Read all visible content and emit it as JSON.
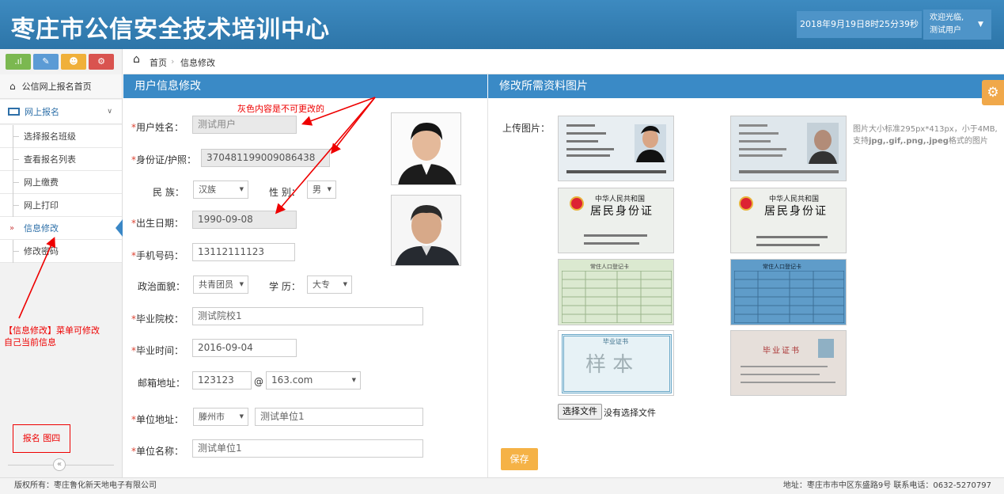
{
  "header": {
    "title": "枣庄市公信安全技术培训中心",
    "datetime": "2018年9月19日8时25分39秒",
    "welcome": "欢迎光临,",
    "username": "测试用户"
  },
  "sidebar": {
    "shortcut_icons": [
      "chart-icon",
      "pencil-icon",
      "group-icon",
      "cogs-icon"
    ],
    "home_label": "公信网上报名首页",
    "section_label": "网上报名",
    "items": [
      {
        "label": "选择报名班级"
      },
      {
        "label": "查看报名列表"
      },
      {
        "label": "网上缴费"
      },
      {
        "label": "网上打印"
      },
      {
        "label": "信息修改"
      },
      {
        "label": "修改密码"
      }
    ],
    "annotation_line1": "【信息修改】菜单可修改",
    "annotation_line2": "自己当前信息",
    "figure_label": "报名 图四",
    "collapse_glyph": "«"
  },
  "breadcrumb": {
    "home": "首页",
    "separator": "›",
    "current": "信息修改"
  },
  "left_panel": {
    "title": "用户信息修改",
    "note": "灰色内容是不可更改的",
    "required_mark": "*",
    "fields": {
      "name": {
        "label": "用户姓名：",
        "value": "测试用户"
      },
      "id": {
        "label": "身份证/护照：",
        "value": "370481199009086438"
      },
      "ethnicity": {
        "label": "民 族：",
        "value": "汉族"
      },
      "gender": {
        "label": "性 别：",
        "value": "男"
      },
      "birth": {
        "label": "出生日期：",
        "value": "1990-09-08"
      },
      "phone": {
        "label": "手机号码：",
        "value": "13112111123"
      },
      "political": {
        "label": "政治面貌：",
        "value": "共青团员"
      },
      "education": {
        "label": "学 历：",
        "value": "大专"
      },
      "school": {
        "label": "毕业院校：",
        "value": "测试院校1"
      },
      "grad_time": {
        "label": "毕业时间：",
        "value": "2016-09-04"
      },
      "email": {
        "label": "邮箱地址：",
        "user": "123123",
        "at": "@",
        "domain": "163.com"
      },
      "work_address": {
        "label": "单位地址：",
        "city": "滕州市",
        "value": "测试单位1"
      },
      "work_name": {
        "label": "单位名称：",
        "value": "测试单位1"
      }
    }
  },
  "right_panel": {
    "title": "修改所需资料图片",
    "upload_label": "上传图片：",
    "hint_line1": "图片大小标准295px*413px，小于4MB,",
    "hint_prefix": "支持",
    "hint_formats": "jpg,.gif,.png,.jpeg",
    "hint_suffix": "格式的图片",
    "choose_file": "选择文件",
    "no_file": "没有选择文件",
    "save": "保存",
    "id_card_title1": "中华人民共和国",
    "id_card_title2": "居民身份证",
    "hukou_title": "常住人口登记卡",
    "diploma_title": "毕业证书",
    "watermark": "样 本"
  },
  "footer": {
    "left": "版权所有：枣庄鲁化新天地电子有限公司",
    "right": "地址：枣庄市市中区东盛路9号 联系电话：0632-5270797"
  },
  "colors": {
    "header": "#3a87ad",
    "panel_head": "#3a8ac6",
    "save_button": "#f5b246",
    "annotation": "#e00000"
  }
}
